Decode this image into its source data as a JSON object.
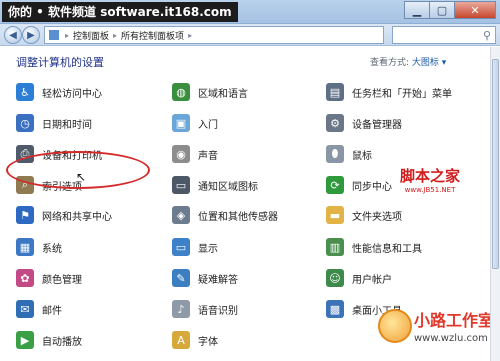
{
  "watermark": "你的 • 软件频道 software.it168.com",
  "breadcrumb": [
    "控制面板",
    "所有控制面板项"
  ],
  "heading": "调整计算机的设置",
  "view": {
    "label": "查看方式:",
    "value": "大图标 ▾"
  },
  "items": [
    {
      "label": "轻松访问中心",
      "icon": "accessibility-icon",
      "color": "#2c7fd4"
    },
    {
      "label": "区域和语言",
      "icon": "globe-clock-icon",
      "color": "#3a8f3e"
    },
    {
      "label": "任务栏和「开始」菜单",
      "icon": "taskbar-icon",
      "color": "#5f6f86"
    },
    {
      "label": "日期和时间",
      "icon": "calendar-clock-icon",
      "color": "#3b6fbf"
    },
    {
      "label": "入门",
      "icon": "getting-started-icon",
      "color": "#6aa6d8"
    },
    {
      "label": "设备管理器",
      "icon": "device-manager-icon",
      "color": "#6b7788"
    },
    {
      "label": "设备和打印机",
      "icon": "printer-icon",
      "color": "#4f5b6a"
    },
    {
      "label": "声音",
      "icon": "speaker-icon",
      "color": "#8c8c8c"
    },
    {
      "label": "鼠标",
      "icon": "mouse-icon",
      "color": "#8a96a6"
    },
    {
      "label": "索引选项",
      "icon": "index-search-icon",
      "color": "#8f7a52"
    },
    {
      "label": "通知区域图标",
      "icon": "notification-area-icon",
      "color": "#4d5866"
    },
    {
      "label": "同步中心",
      "icon": "sync-icon",
      "color": "#2e9a3c"
    },
    {
      "label": "网络和共享中心",
      "icon": "network-icon",
      "color": "#2d69c2"
    },
    {
      "label": "位置和其他传感器",
      "icon": "sensor-icon",
      "color": "#6c7c8e"
    },
    {
      "label": "文件夹选项",
      "icon": "folder-icon",
      "color": "#e2b448"
    },
    {
      "label": "系统",
      "icon": "computer-icon",
      "color": "#3c78c4"
    },
    {
      "label": "显示",
      "icon": "display-icon",
      "color": "#3d82c9"
    },
    {
      "label": "性能信息和工具",
      "icon": "performance-icon",
      "color": "#4a8f4e"
    },
    {
      "label": "颜色管理",
      "icon": "color-management-icon",
      "color": "#c44a86"
    },
    {
      "label": "疑难解答",
      "icon": "troubleshooting-icon",
      "color": "#3c7fc0"
    },
    {
      "label": "用户帐户",
      "icon": "user-accounts-icon",
      "color": "#3d8a4a"
    },
    {
      "label": "邮件",
      "icon": "mail-icon",
      "color": "#2f6db5"
    },
    {
      "label": "语音识别",
      "icon": "microphone-icon",
      "color": "#8e9aa8"
    },
    {
      "label": "桌面小工具",
      "icon": "gadgets-icon",
      "color": "#3b72b8"
    },
    {
      "label": "自动播放",
      "icon": "autoplay-icon",
      "color": "#3aa046"
    },
    {
      "label": "字体",
      "icon": "fonts-icon",
      "color": "#d6a93a"
    }
  ],
  "logo1": {
    "big": "脚本之家",
    "small": "www.JB51.NET"
  },
  "logo2": {
    "big": "小路工作室",
    "small": "www.wzlu.com"
  }
}
